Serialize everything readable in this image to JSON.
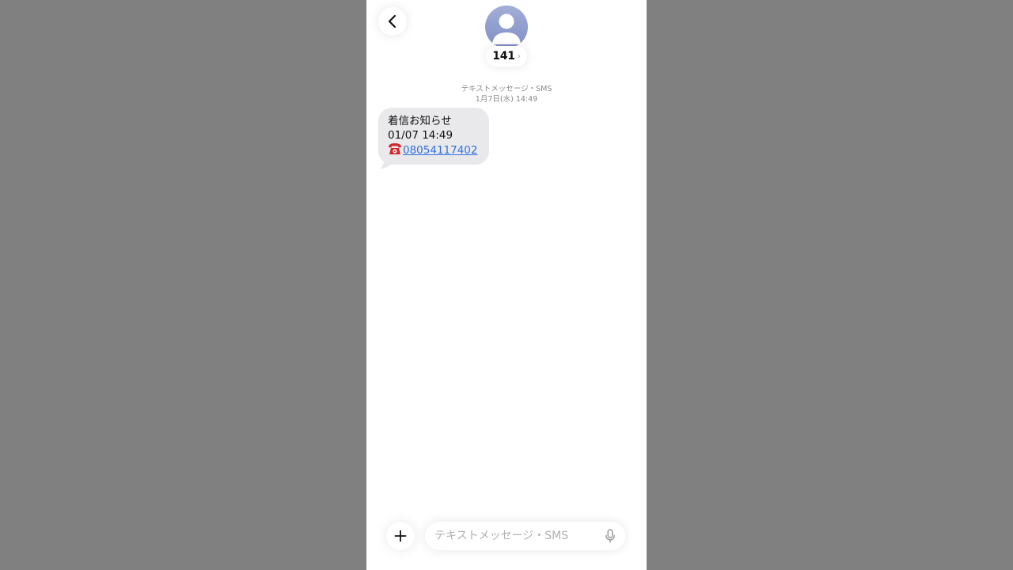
{
  "header": {
    "back_icon": "chevron-left-icon",
    "avatar_icon": "person-silhouette-icon",
    "contact_name": "141",
    "contact_chevron": "›"
  },
  "thread": {
    "message_type": "テキストメッセージ・SMS",
    "date_label": "1月7日(水) 14:49"
  },
  "messages": [
    {
      "direction": "incoming",
      "line1": "着信お知らせ",
      "line2": "01/07 14:49",
      "phone_icon": "telephone-emoji-icon",
      "phone_number": "08054117402"
    }
  ],
  "composer": {
    "plus_icon": "plus-icon",
    "placeholder": "テキストメッセージ・SMS",
    "value": "",
    "mic_icon": "microphone-icon"
  },
  "colors": {
    "background": "#808080",
    "screen": "#ffffff",
    "incoming_bubble": "#e9e9eb",
    "link": "#2f6fe0",
    "avatar_top": "#a3afd7",
    "avatar_bottom": "#7f8ec4"
  }
}
